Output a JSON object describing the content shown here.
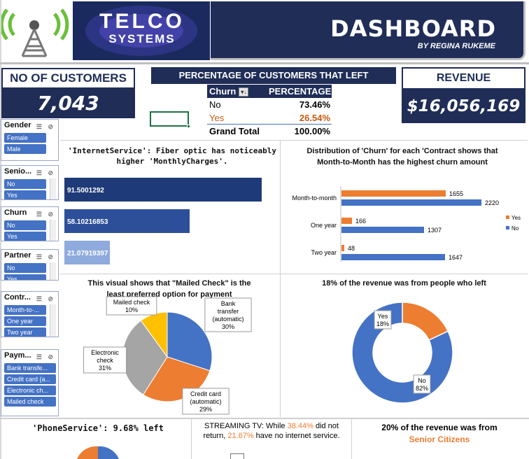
{
  "header": {
    "brand_line1": "TELCO",
    "brand_line2": "SYSTEMS",
    "title": "DASHBOARD",
    "author": "BY REGINA RUKEME",
    "logo_icon": "antenna-tower-icon"
  },
  "kpis": {
    "customers_label": "NO OF CUSTOMERS",
    "customers_value": "7,043",
    "revenue_label": "REVENUE",
    "revenue_value": "$16,056,169"
  },
  "churn_table": {
    "title": "PERCENTAGE OF CUSTOMERS THAT LEFT",
    "header_col1": "Churn",
    "header_col2": "PERCENTAGE",
    "rows": [
      {
        "label": "No",
        "value": "73.46%"
      },
      {
        "label": "Yes",
        "value": "26.54%"
      }
    ],
    "total_label": "Grand Total",
    "total_value": "100.00%"
  },
  "slicers": [
    {
      "title": "Gender",
      "items": [
        "Female",
        "Male"
      ]
    },
    {
      "title": "Senio...",
      "items": [
        "No",
        "Yes"
      ]
    },
    {
      "title": "Churn",
      "items": [
        "No",
        "Yes"
      ]
    },
    {
      "title": "Partner",
      "items": [
        "No",
        "Yes"
      ]
    },
    {
      "title": "Contr...",
      "items": [
        "Month-to-...",
        "One year",
        "Two year"
      ]
    },
    {
      "title": "Paym...",
      "items": [
        "Bank transfe...",
        "Credit card (a...",
        "Electronic ch...",
        "Mailed check"
      ]
    }
  ],
  "panels": {
    "internet_title": "'InternetService': Fiber optic has noticeably higher 'MonthlyCharges'.",
    "contract_title": "Distribution of 'Churn' for each 'Contract shows that Month-to-Month has the highest churn amount",
    "payment_title": "This visual shows that \"Mailed Check\" is the least preferred option for payment",
    "revenue_title": "18%  of the revenue was from people who left",
    "phone_title": "'PhoneService': 9.68% left",
    "streaming_pre": "STREAMING TV: While ",
    "streaming_pct1": "38.44%",
    "streaming_mid": " did not return, ",
    "streaming_pct2": "21.67%",
    "streaming_post": " have no internet service.",
    "senior_title": "20% of the revenue was from",
    "senior_highlight": "Senior Citizens"
  },
  "colors": {
    "navy": "#1f2d57",
    "blue": "#4472c4",
    "orange": "#ed7d31",
    "gray": "#a5a5a5",
    "gold": "#ffc000"
  },
  "chart_data": [
    {
      "type": "bar",
      "orientation": "horizontal",
      "data_labels": [
        "91.5001292",
        "58.10216853",
        "21.07919397"
      ],
      "values": [
        91.5001292,
        58.10216853,
        21.07919397
      ]
    },
    {
      "type": "bar",
      "orientation": "horizontal",
      "categories": [
        "Month-to-month",
        "One year",
        "Two year"
      ],
      "series": [
        {
          "name": "Yes",
          "values": [
            1655,
            166,
            48
          ]
        },
        {
          "name": "No",
          "values": [
            2220,
            1307,
            1647
          ]
        }
      ],
      "legend": "right"
    },
    {
      "type": "pie",
      "labels": [
        "Bank transfer (automatic)",
        "Credit card (automatic)",
        "Electronic check",
        "Mailed check"
      ],
      "label_lines": [
        [
          "Bank",
          "transfer",
          "(automatic)",
          "30%"
        ],
        [
          "Credit card",
          "(automatic)",
          "29%"
        ],
        [
          "Electronic",
          "check",
          "31%"
        ],
        [
          "Mailed check",
          "10%"
        ]
      ],
      "values": [
        30,
        29,
        31,
        10
      ]
    },
    {
      "type": "pie",
      "variant": "donut",
      "labels": [
        "Yes",
        "No"
      ],
      "label_lines": [
        [
          "Yes",
          "18%"
        ],
        [
          "No",
          "82%"
        ]
      ],
      "values": [
        18,
        82
      ]
    }
  ]
}
